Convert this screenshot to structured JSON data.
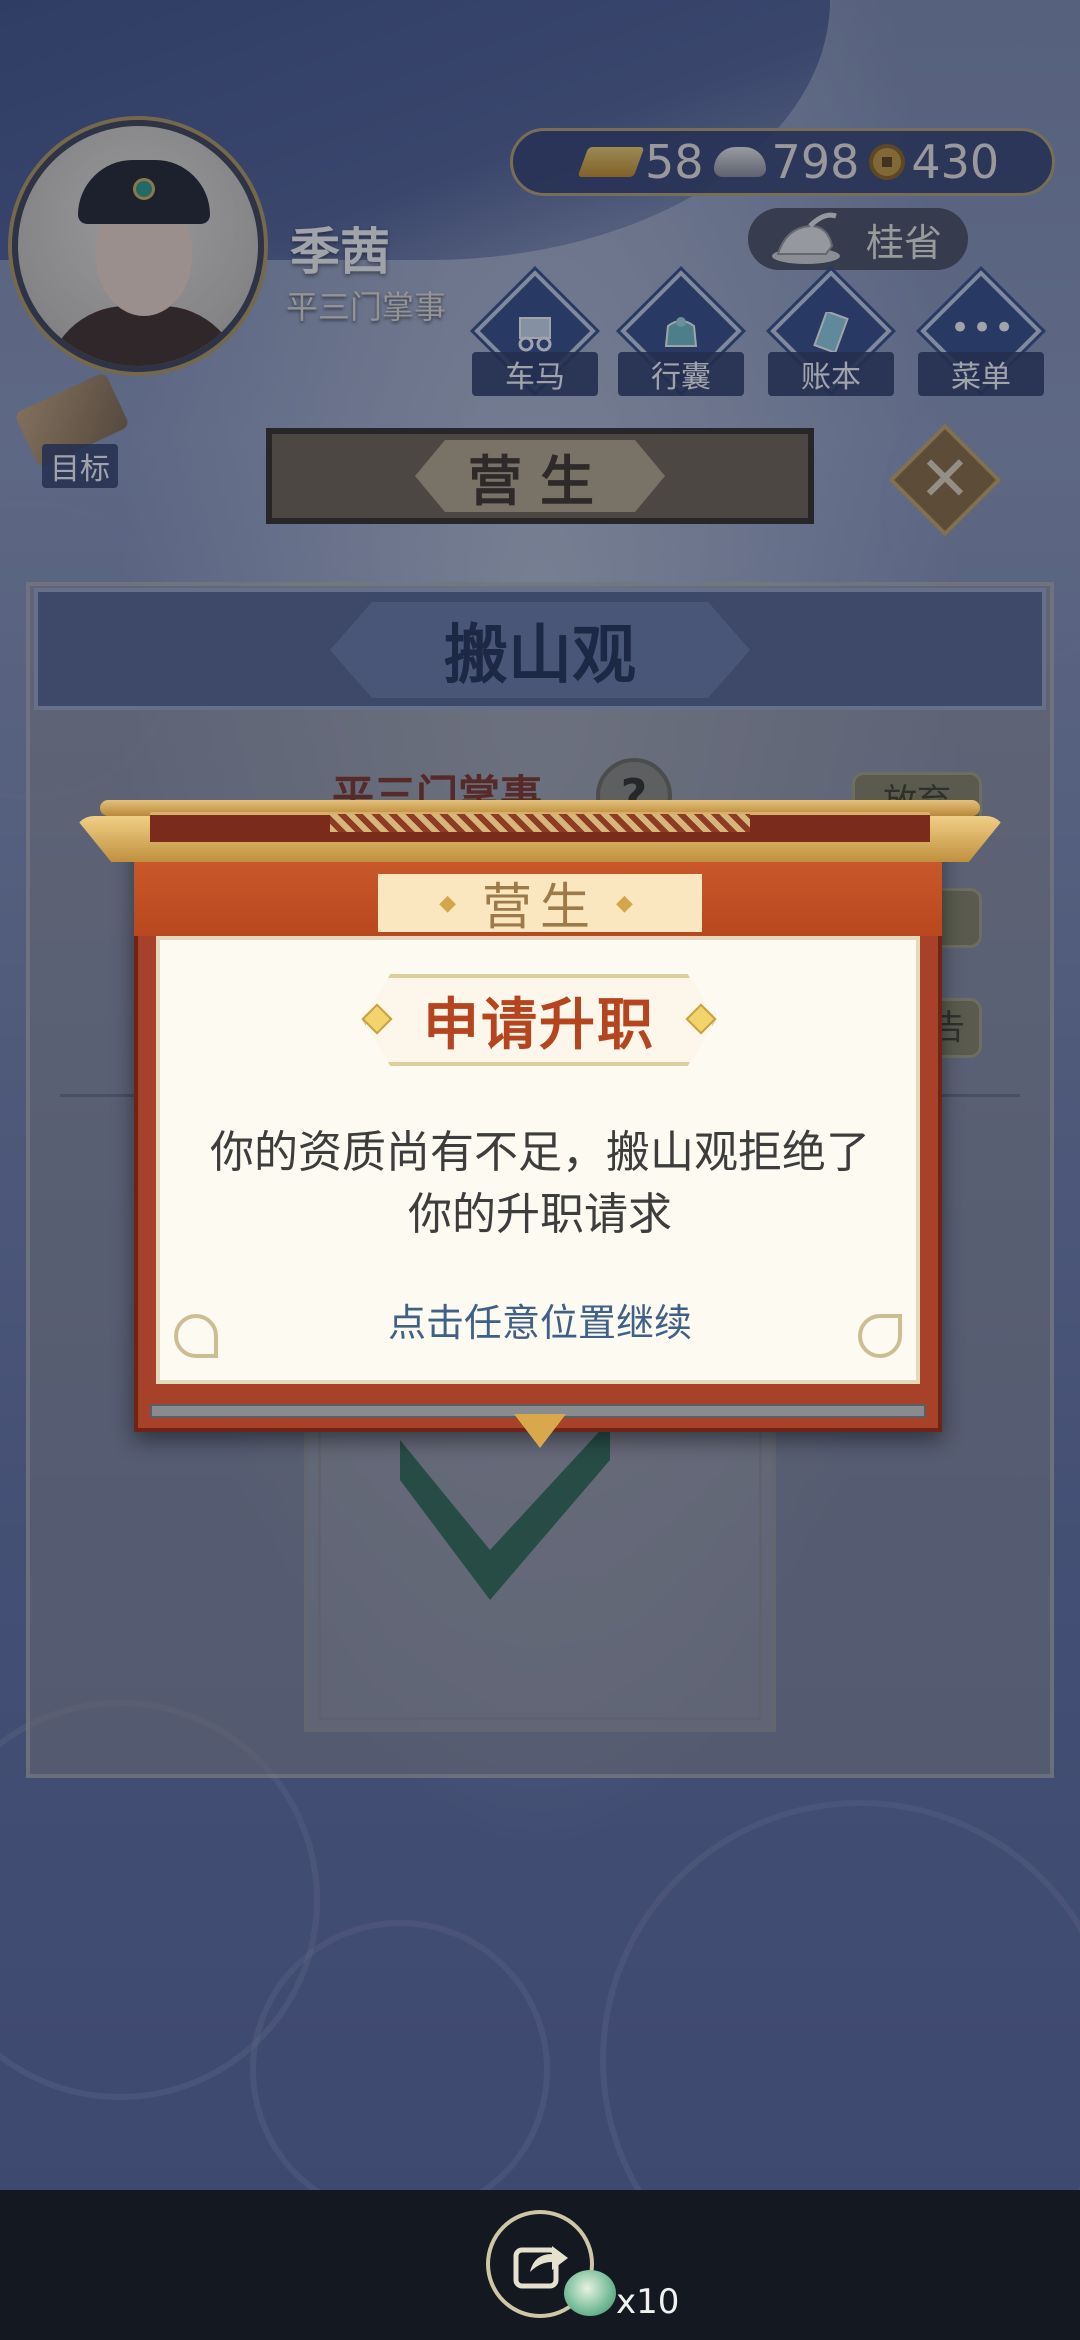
{
  "player": {
    "name": "季茜",
    "title": "平三门掌事"
  },
  "resources": {
    "gold": "58",
    "silver": "798",
    "copper": "430"
  },
  "location": "桂省",
  "menu": {
    "items": [
      {
        "label": "车马",
        "icon": "carriage-icon"
      },
      {
        "label": "行囊",
        "icon": "bag-icon"
      },
      {
        "label": "账本",
        "icon": "ledger-icon"
      },
      {
        "label": "菜单",
        "icon": "more-icon"
      }
    ]
  },
  "goal_label": "目标",
  "screen_title": "营生",
  "panel": {
    "title": "搬山观",
    "behind": {
      "role": "平三门掌事",
      "help": "?",
      "button_1": "放弃",
      "button_3": "告"
    }
  },
  "dialog": {
    "header": "营生",
    "subtitle": "申请升职",
    "message_line1": "你的资质尚有不足，搬山观拒绝了",
    "message_line2": "你的升职请求",
    "hint": "点击任意位置继续"
  },
  "share": {
    "reward_count": "x10"
  },
  "colors": {
    "dialog_red": "#a7412a",
    "dialog_orange": "#c8582a",
    "subtitle_red": "#b5451f",
    "hint_blue": "#3f6188",
    "navy": "#2f4a86"
  }
}
